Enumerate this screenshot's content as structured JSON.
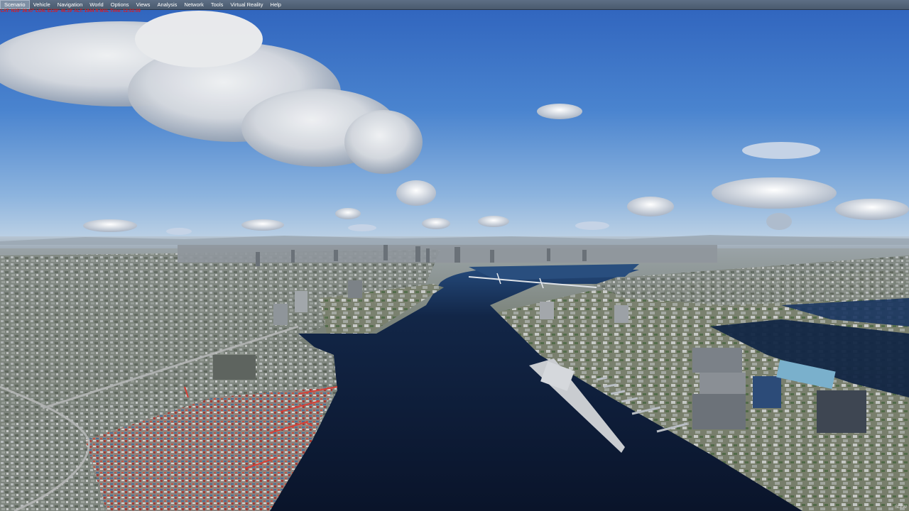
{
  "menubar": {
    "items": [
      {
        "label": "Scenario",
        "active": true
      },
      {
        "label": "Vehicle"
      },
      {
        "label": "Navigation"
      },
      {
        "label": "World"
      },
      {
        "label": "Options"
      },
      {
        "label": "Views"
      },
      {
        "label": "Analysis"
      },
      {
        "label": "Network"
      },
      {
        "label": "Tools"
      },
      {
        "label": "Virtual Reality"
      },
      {
        "label": "Help"
      }
    ]
  },
  "hud": {
    "readout": "LAT: N35° 36.47'  LON: E139° 46.19'  ALT: 1944 ft  MSL  Time: 12:02:09",
    "color": "#e0191f"
  },
  "status": {
    "indicator": "SLEW"
  },
  "scene": {
    "description_colors": {
      "sky_top": "#2d63bd",
      "sky_horizon": "#b9cde0",
      "water": "#0d1a33",
      "land": "#6d7466"
    }
  }
}
